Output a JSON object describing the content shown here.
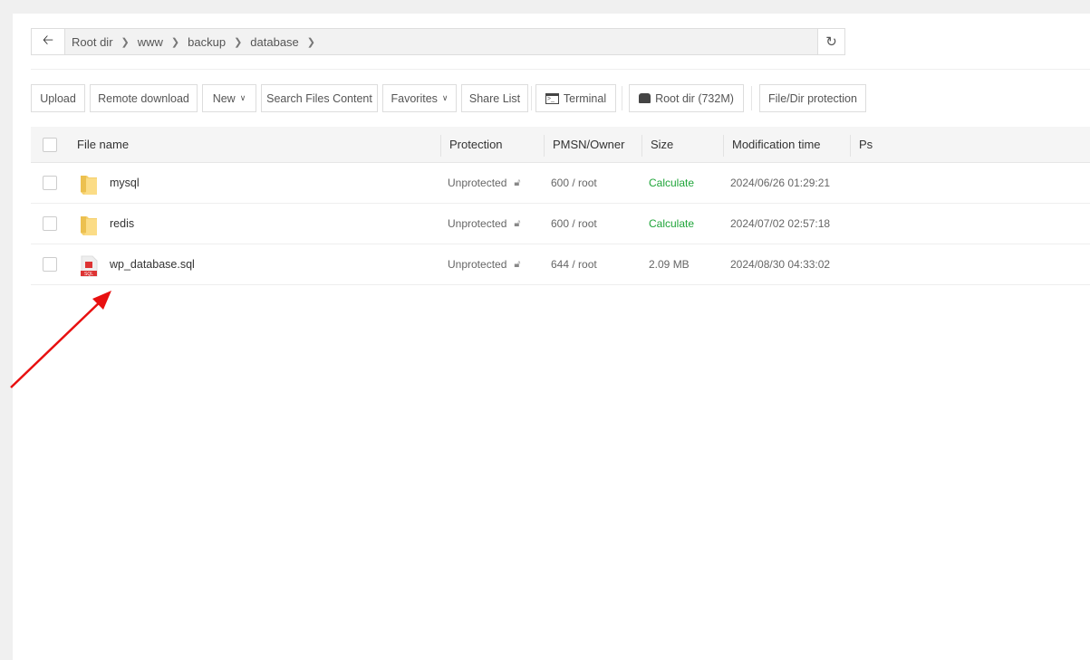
{
  "breadcrumb": {
    "items": [
      "Root dir",
      "www",
      "backup",
      "database"
    ]
  },
  "toolbar": {
    "upload": "Upload",
    "remote_download": "Remote download",
    "new": "New",
    "search_content": "Search Files Content",
    "favorites": "Favorites",
    "share_list": "Share List",
    "terminal": "Terminal",
    "root_dir": "Root dir (732M)",
    "protection": "File/Dir protection"
  },
  "table": {
    "headers": [
      "File name",
      "Protection",
      "PMSN/Owner",
      "Size",
      "Modification time",
      "Ps"
    ],
    "rows": [
      {
        "name": "mysql",
        "type": "folder",
        "protection": "Unprotected",
        "perm": "600 / root",
        "size": "Calculate",
        "mtime": "2024/06/26 01:29:21"
      },
      {
        "name": "redis",
        "type": "folder",
        "protection": "Unprotected",
        "perm": "600 / root",
        "size": "Calculate",
        "mtime": "2024/07/02 02:57:18"
      },
      {
        "name": "wp_database.sql",
        "type": "sql",
        "protection": "Unprotected",
        "perm": "644 / root",
        "size": "2.09 MB",
        "mtime": "2024/08/30 04:33:02"
      }
    ]
  },
  "sql_badge": "SQL",
  "colors": {
    "accent": "#20a53a",
    "arrow": "#e81010"
  }
}
